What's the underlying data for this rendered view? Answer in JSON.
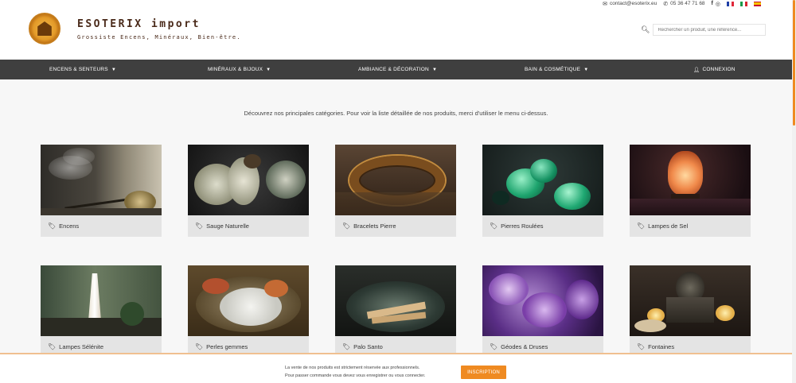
{
  "topbar": {
    "email": "contact@esoterix.eu",
    "phone": "05 36 47 71 68",
    "social": [
      {
        "icon": "facebook-icon",
        "glyph": "f"
      },
      {
        "icon": "instagram-icon",
        "glyph": "◎"
      }
    ],
    "languages": [
      {
        "icon": "flag-france-icon",
        "colors": [
          "#1f3fa6",
          "#ffffff",
          "#e0283a"
        ]
      },
      {
        "icon": "flag-italy-icon",
        "colors": [
          "#1a9a4a",
          "#ffffff",
          "#d8242f"
        ]
      },
      {
        "icon": "flag-spain-icon",
        "colors": [
          "#c8102e",
          "#f6c400",
          "#c8102e"
        ]
      }
    ]
  },
  "brand": {
    "name": "ESOTERIX import",
    "tagline": "Grossiste Encens, Minéraux, Bien-être."
  },
  "search": {
    "placeholder": "Rechercher un produit, une référence..."
  },
  "nav": {
    "items": [
      {
        "label": "ENCENS & SENTEURS",
        "has_caret": true
      },
      {
        "label": "MINÉRAUX & BIJOUX",
        "has_caret": true
      },
      {
        "label": "AMBIANCE & DÉCORATION",
        "has_caret": true
      },
      {
        "label": "BAIN & COSMÉTIQUE",
        "has_caret": true
      }
    ],
    "login": "CONNEXION"
  },
  "intro": "Découvrez nos principales catégories. Pour voir la liste détaillée de nos produits, merci d'utiliser le menu ci-dessus.",
  "categories": [
    {
      "label": "Encens"
    },
    {
      "label": "Sauge Naturelle"
    },
    {
      "label": "Bracelets Pierre"
    },
    {
      "label": "Pierres Roulées"
    },
    {
      "label": "Lampes de Sel"
    },
    {
      "label": "Lampes Sélénite"
    },
    {
      "label": "Perles gemmes"
    },
    {
      "label": "Palo Santo"
    },
    {
      "label": "Géodes & Druses"
    },
    {
      "label": "Fontaines"
    }
  ],
  "cookie": {
    "line1": "La vente de nos produits est strictement réservée aux professionnels.",
    "line2": "Pour passer commande vous devez vous enregistrer ou vous connecter.",
    "button": "INSCRIPTION"
  },
  "colors": {
    "accent": "#ef8a21",
    "nav_bg": "#3f3f3f",
    "caption_bg": "#e4e4e4",
    "page_bg": "#f7f7f7"
  }
}
